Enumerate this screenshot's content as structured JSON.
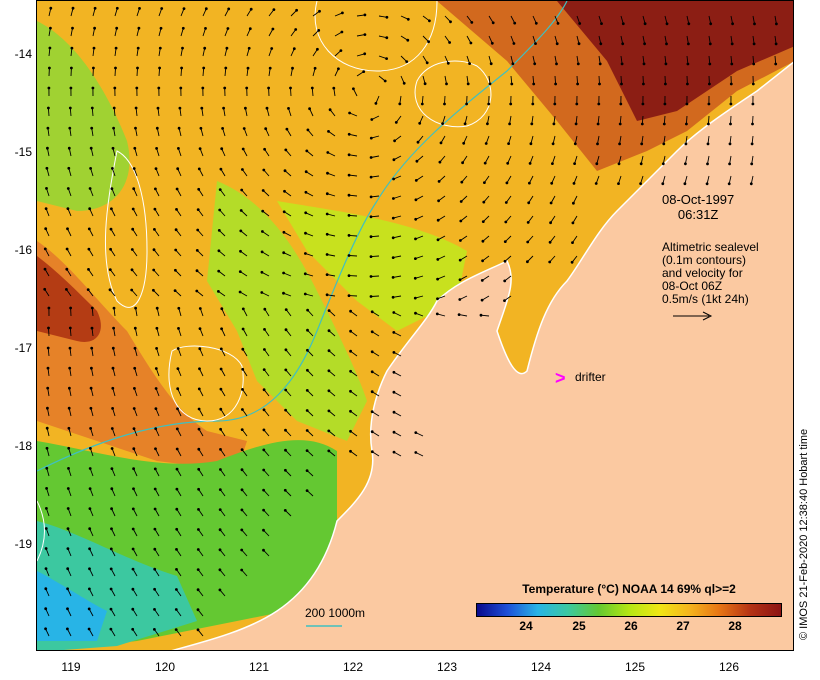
{
  "map": {
    "lat_labels": [
      "-14",
      "-15",
      "-16",
      "-17",
      "-18",
      "-19"
    ],
    "lon_labels": [
      "119",
      "120",
      "121",
      "122",
      "123",
      "124",
      "125",
      "126"
    ],
    "date": "08-Oct-1997",
    "time": "06:31Z",
    "info_lines": [
      "Altimetric sealevel",
      "(0.1m contours)",
      "and velocity for",
      "08-Oct 06Z",
      "0.5m/s (1kt 24h)"
    ],
    "drifter_symbol": ">",
    "drifter_label": "drifter",
    "depth_legend": "200  1000m",
    "credit": "© IMOS 21-Feb-2020 12:38:40 Hobart time",
    "colors": {
      "land": "#fbc9a1",
      "warm": "#e69a28",
      "hot": "#8c1414",
      "cool": "#64c832",
      "coldest": "#28b4e6",
      "drifter": "#ff00ff",
      "contour": "#ffffff",
      "isobath": "#40c0c0"
    }
  },
  "legend": {
    "title": "Temperature (°C) NOAA 14 69% ql>=2",
    "ticks": [
      "24",
      "25",
      "26",
      "27",
      "28"
    ]
  }
}
